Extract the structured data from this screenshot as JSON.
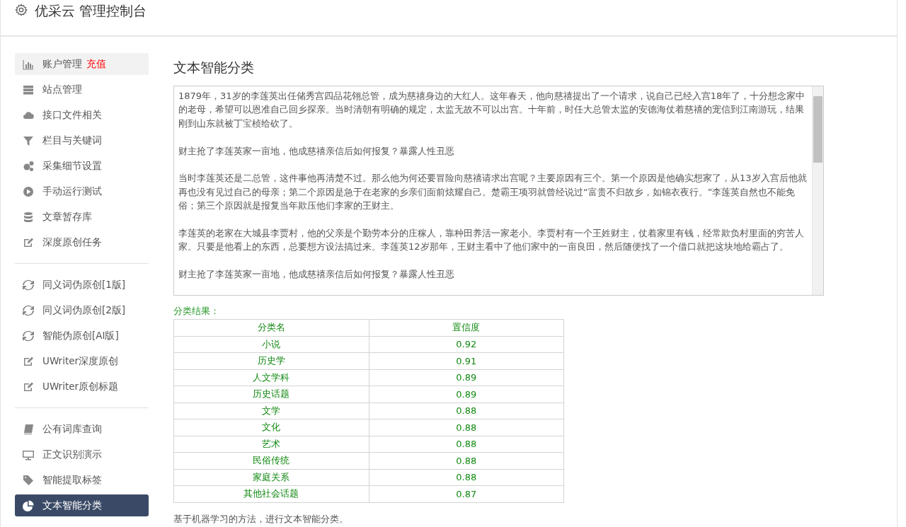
{
  "header": {
    "title": "优采云 管理控制台"
  },
  "sidebar": {
    "groups": [
      {
        "items": [
          {
            "label": "账户管理",
            "badge": "充值",
            "selected": false,
            "highlighted": true
          },
          {
            "label": "站点管理",
            "selected": false,
            "highlighted": false
          },
          {
            "label": "接口文件相关",
            "selected": false,
            "highlighted": false
          },
          {
            "label": "栏目与关键词",
            "selected": false,
            "highlighted": false
          },
          {
            "label": "采集细节设置",
            "selected": false,
            "highlighted": false
          },
          {
            "label": "手动运行测试",
            "selected": false,
            "highlighted": false
          },
          {
            "label": "文章暂存库",
            "selected": false,
            "highlighted": false
          },
          {
            "label": "深度原创任务",
            "selected": false,
            "highlighted": false
          }
        ]
      },
      {
        "items": [
          {
            "label": "同义词伪原创[1版]",
            "selected": false,
            "highlighted": false
          },
          {
            "label": "同义词伪原创[2版]",
            "selected": false,
            "highlighted": false
          },
          {
            "label": "智能伪原创[AI版]",
            "selected": false,
            "highlighted": false
          },
          {
            "label": "UWriter深度原创",
            "selected": false,
            "highlighted": false
          },
          {
            "label": "UWriter原创标题",
            "selected": false,
            "highlighted": false
          }
        ]
      },
      {
        "items": [
          {
            "label": "公有词库查询",
            "selected": false,
            "highlighted": false
          },
          {
            "label": "正文识别演示",
            "selected": false,
            "highlighted": false
          },
          {
            "label": "智能提取标签",
            "selected": false,
            "highlighted": false
          },
          {
            "label": "文本智能分类",
            "selected": true,
            "highlighted": false
          }
        ]
      }
    ]
  },
  "main": {
    "title": "文本智能分类",
    "input_text": [
      "1879年，31岁的李莲英出任储秀宫四品花翎总管，成为慈禧身边的大红人。这年春天，他向慈禧提出了一个请求，说自己已经入宫18年了，十分想念家中的老母，希望可以恩准自己回乡探亲。当时清朝有明确的规定，太监无故不可以出宫。十年前，时任大总管太监的安德海仗着慈禧的宠信到江南游玩，结果刚到山东就被丁宝桢给砍了。",
      "财主抢了李莲英家一亩地，他成慈禧亲信后如何报复？暴露人性丑恶",
      "当时李莲英还是二总管，这件事他再清楚不过。那么他为何还要冒险向慈禧请求出宫呢？主要原因有三个。第一个原因是他确实想家了，从13岁入宫后他就再也没有见过自己的母亲；第二个原因是急于在老家的乡亲们面前炫耀自己。楚霸王项羽就曾经说过“富贵不归故乡，如锦衣夜行。”李莲英自然也不能免俗；第三个原因就是报复当年欺压他们李家的王财主。",
      "李莲英的老家在大城县李贾村，他的父亲是个勤劳本分的庄稼人，靠种田养活一家老小。李贾村有一个王姓财主，仗着家里有钱，经常欺负村里面的穷苦人家。只要是他看上的东西，总要想方设法搞过来。李莲英12岁那年，王财主看中了他们家中的一亩良田，然后随便找了一个借口就把这块地给霸占了。",
      "财主抢了李莲英家一亩地，他成慈禧亲信后如何报复？暴露人性丑恶"
    ],
    "result_label": "分类结果：",
    "table": {
      "columns": [
        "分类名",
        "置信度"
      ],
      "rows": [
        [
          "小说",
          "0.92"
        ],
        [
          "历史学",
          "0.91"
        ],
        [
          "人文学科",
          "0.89"
        ],
        [
          "历史话题",
          "0.89"
        ],
        [
          "文学",
          "0.88"
        ],
        [
          "文化",
          "0.88"
        ],
        [
          "艺术",
          "0.88"
        ],
        [
          "民俗传统",
          "0.88"
        ],
        [
          "家庭关系",
          "0.88"
        ],
        [
          "其他社会话题",
          "0.87"
        ]
      ]
    },
    "footnote": "基于机器学习的方法，进行文本智能分类。"
  }
}
